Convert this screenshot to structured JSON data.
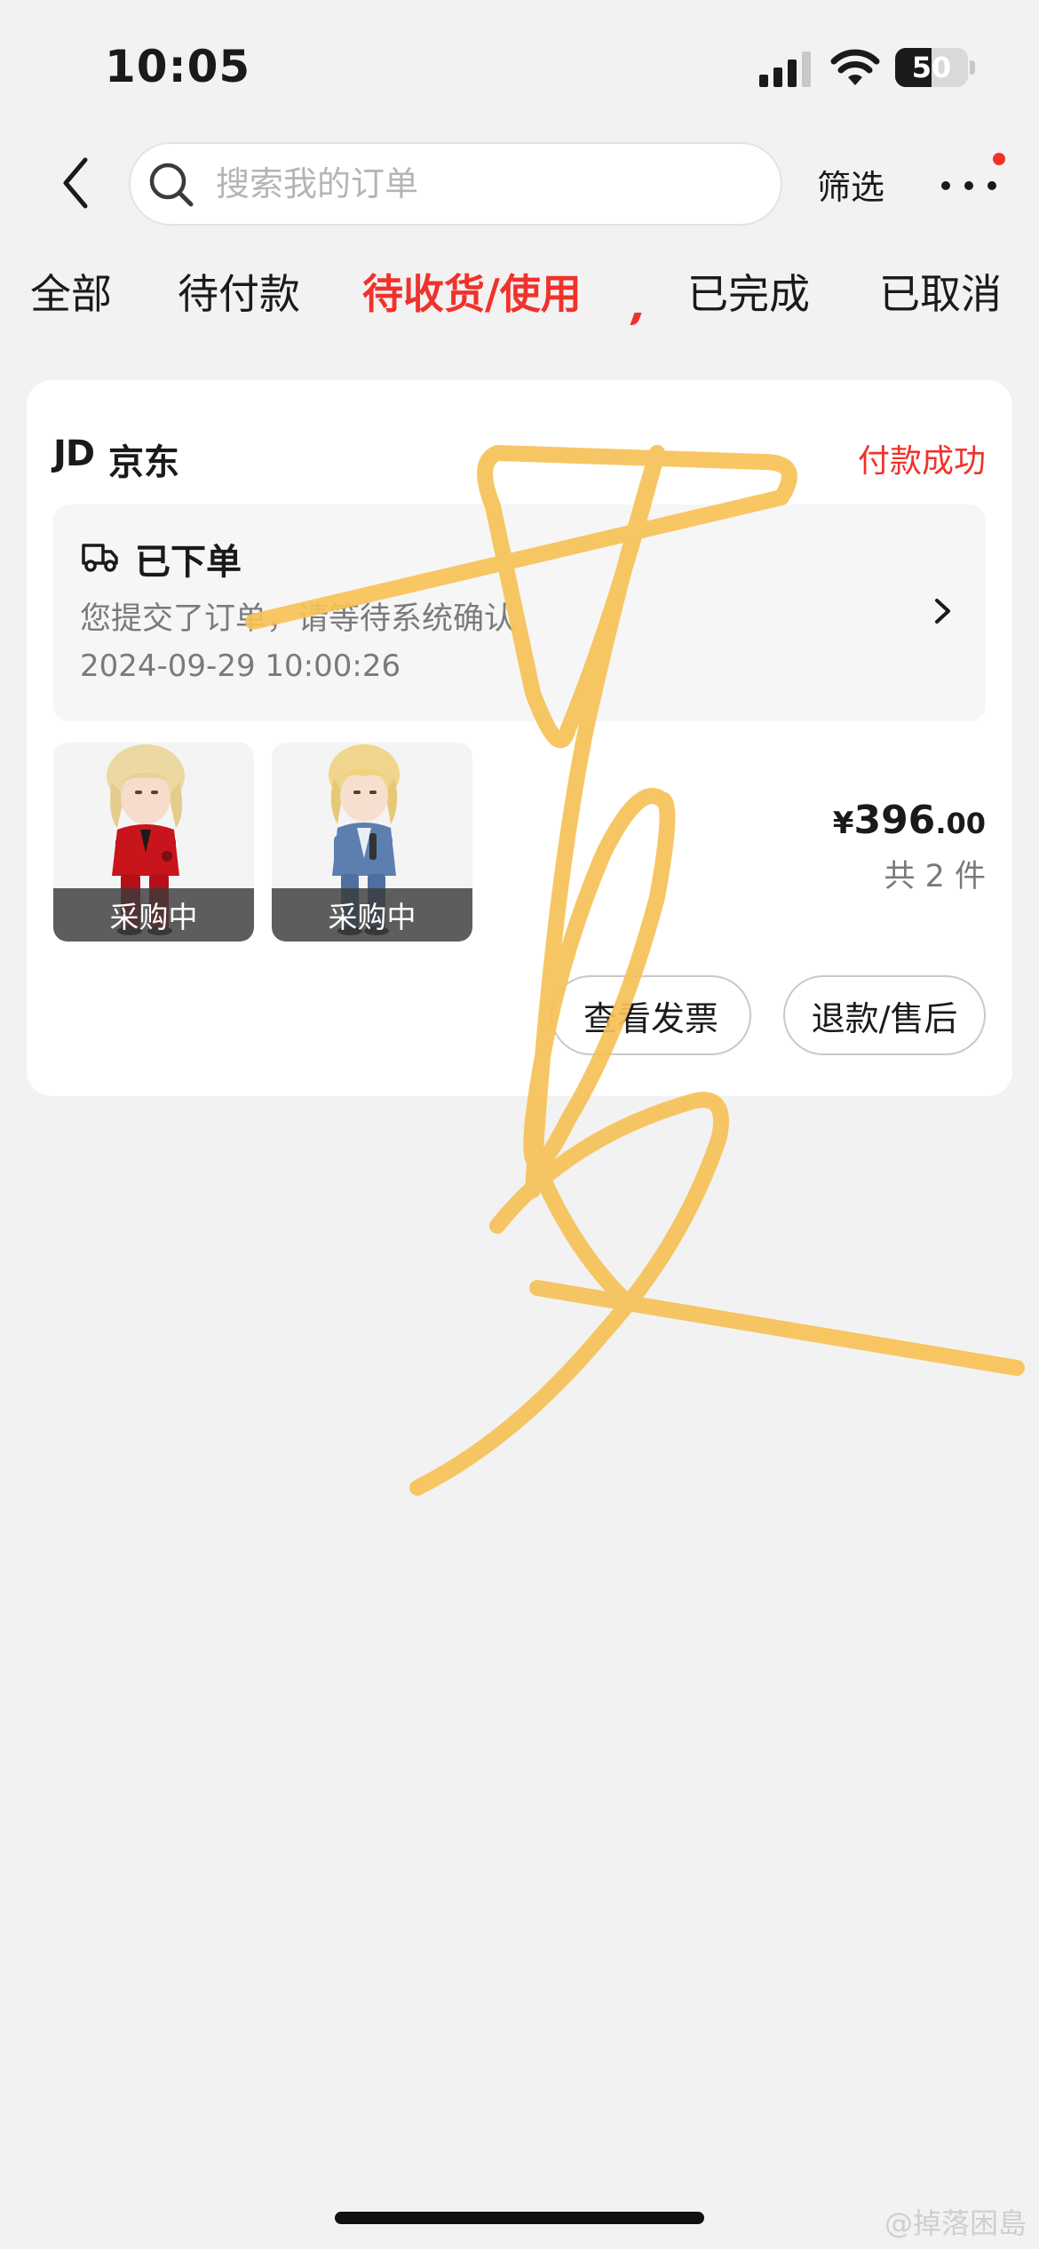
{
  "status_bar": {
    "time": "10:05",
    "battery": "50",
    "battery_level": 0.5
  },
  "nav": {
    "search_placeholder": "搜索我的订单",
    "filter_label": "筛选",
    "icons": {
      "back": "chevron-left-icon",
      "search": "search-icon",
      "more": "more-icon"
    }
  },
  "tabs": [
    {
      "label": "全部",
      "active": false
    },
    {
      "label": "待付款",
      "active": false
    },
    {
      "label": "待收货/使用",
      "active": true
    },
    {
      "label": "已完成",
      "active": false
    },
    {
      "label": "已取消",
      "active": false
    }
  ],
  "order": {
    "shop_logo": "JD",
    "shop_name": "京东",
    "status": "付款成功",
    "progress": {
      "title": "已下单",
      "description": "您提交了订单，请等待系统确认",
      "time": "2024-09-29 10:00:26",
      "icon": "truck-icon"
    },
    "products": [
      {
        "badge": "采购中",
        "color": "red-suit"
      },
      {
        "badge": "采购中",
        "color": "blue-suit"
      }
    ],
    "price": {
      "symbol": "¥",
      "integer": "396",
      "decimal": ".00"
    },
    "quantity": "共 2 件",
    "buttons": {
      "invoice": "查看发票",
      "refund": "退款/售后"
    }
  },
  "watermark": "@掉落困島",
  "colors": {
    "accent": "#f0322c",
    "background": "#f2f2f2",
    "scribble": "#f7c257"
  }
}
